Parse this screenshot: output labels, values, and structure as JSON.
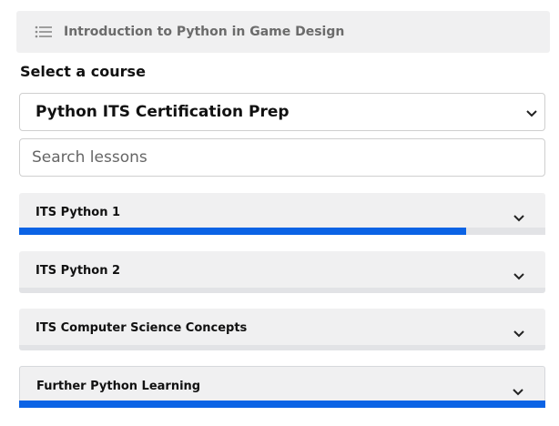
{
  "header": {
    "title": "Introduction to Python in Game Design",
    "icon": "list-icon"
  },
  "course_select": {
    "label": "Select a course",
    "value": "Python ITS Certification Prep"
  },
  "search": {
    "placeholder": "Search lessons",
    "value": ""
  },
  "courses": [
    {
      "label": "ITS Python 1",
      "progress": 0.85
    },
    {
      "label": "ITS Python 2",
      "progress": 0
    },
    {
      "label": "ITS Computer Science Concepts",
      "progress": 0
    },
    {
      "label": "Further Python Learning",
      "progress": 1.0
    }
  ],
  "colors": {
    "accent": "#0b63e5",
    "panel": "#f0f0f1"
  }
}
